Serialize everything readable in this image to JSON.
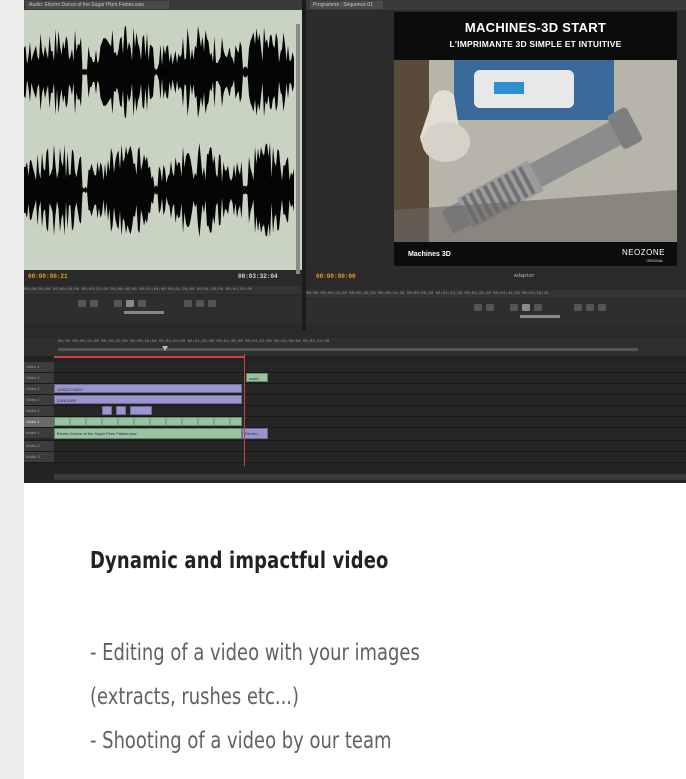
{
  "editor": {
    "source_tab": "Audio: Electro Dance of the Sugar Plum Fairies.wav",
    "program_tab": "Programme : Séquence 01",
    "source_timecode_in": "00:00:00:21",
    "source_timecode_out": "00:03:32:04",
    "program_timecode_in": "00:00:00:00",
    "program_fit": "Adapter",
    "source_ruler": "00;00;00;00  00;00;16;00  00;00;32;00  00;00;48;00  00;01;04;00  00;01;20;00  00;01;36;00  00;01;52;00",
    "program_ruler": "00;00  00;00;14;29  00;00;29;29  00;00;44;29  00;00;59;28  00;01;14;28  00;01;29;28  00;01;44;28  00;01;59;28",
    "timeline_ruler": "00;00  00;00;16;00  00;00;32;00  00;00;48;00  00;01;04;00  00;01;20;00  00;01;36;00  00;01;52;00  00;02;08;00  00;02;24;00",
    "video_frame": {
      "title": "MACHINES-3D START",
      "subtitle": "L'IMPRIMANTE  3D SIMPLE ET INTUITIVE",
      "footer_left": "Machines 3D",
      "footer_brand": "NEOZONE",
      "footer_brand_sub": "ORIGINAL"
    },
    "tracks": [
      {
        "label": "Vidéo 4"
      },
      {
        "label": "Vidéo 3"
      },
      {
        "label": "Vidéo 2"
      },
      {
        "label": "Vidéo 1"
      },
      {
        "label": "Vidéo 1"
      },
      {
        "label": "Audio 1"
      },
      {
        "label": "Audio 2"
      },
      {
        "label": "Audio 3"
      }
    ],
    "clips": {
      "v3_small": "mach",
      "v2": "1090270.MOV",
      "v2b": "ZUNCHIRI",
      "audio_main": "Electro Dance of the Sugar Plum Fairies.wav",
      "audio_end": "Electro..."
    }
  },
  "article": {
    "heading": "Dynamic and impactful video",
    "lines": [
      "- Editing of a video with your images",
      "(extracts, rushes etc...)",
      "- Shooting of a video by our team"
    ]
  },
  "colors": {
    "page_bg": "#ececec",
    "card_bg": "#ffffff",
    "heading": "#222222",
    "body_text": "#616161",
    "waveform_bg": "#c9d3c1"
  }
}
